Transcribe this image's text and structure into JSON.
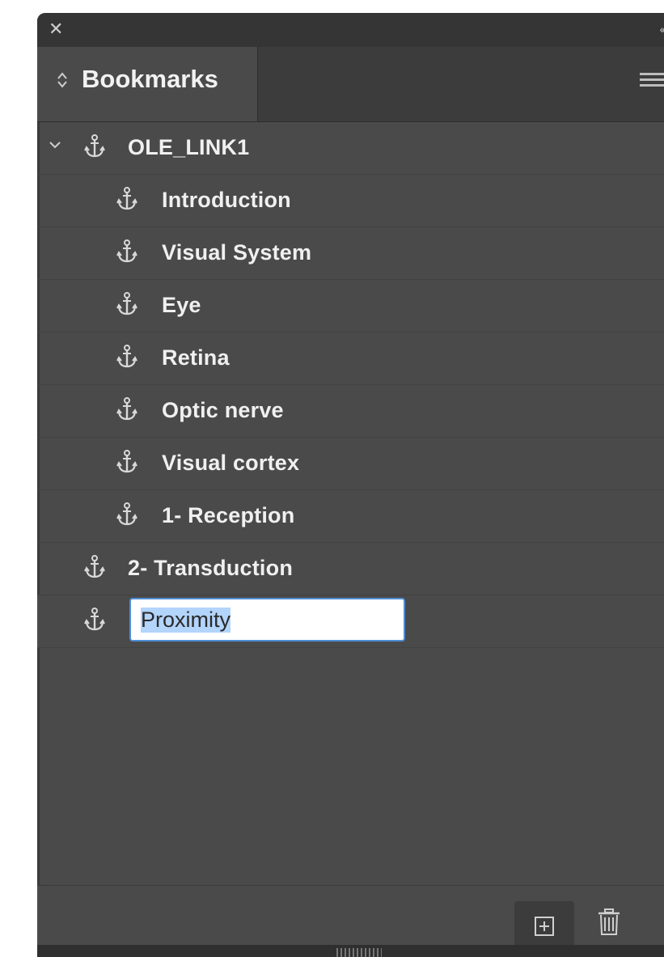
{
  "panel": {
    "close_icon": "close-icon",
    "collapse_icon": "collapse-panel-icon",
    "tab_label": "Bookmarks",
    "menu_icon": "panel-menu-icon"
  },
  "bookmarks": [
    {
      "label": "OLE_LINK1",
      "level": 0,
      "expanded": true,
      "icon": "anchor-icon"
    },
    {
      "label": "Introduction",
      "level": 1,
      "icon": "anchor-icon"
    },
    {
      "label": "Visual System",
      "level": 1,
      "icon": "anchor-icon"
    },
    {
      "label": "Eye",
      "level": 1,
      "icon": "anchor-icon"
    },
    {
      "label": "Retina",
      "level": 1,
      "icon": "anchor-icon"
    },
    {
      "label": "Optic nerve",
      "level": 1,
      "icon": "anchor-icon"
    },
    {
      "label": "Visual cortex",
      "level": 1,
      "icon": "anchor-icon"
    },
    {
      "label": "1- Reception",
      "level": 1,
      "icon": "anchor-icon"
    },
    {
      "label": "2- Transduction",
      "level": 0,
      "icon": "anchor-icon"
    }
  ],
  "rename": {
    "value": "Proximity",
    "icon": "anchor-icon"
  },
  "footer": {
    "new_bookmark_icon": "new-bookmark-icon",
    "delete_icon": "trash-icon"
  },
  "colors": {
    "panel_bg": "#4a4a4a",
    "topbar_bg": "#353535",
    "input_border": "#4f8fd6",
    "selection": "#b3d4fb"
  }
}
